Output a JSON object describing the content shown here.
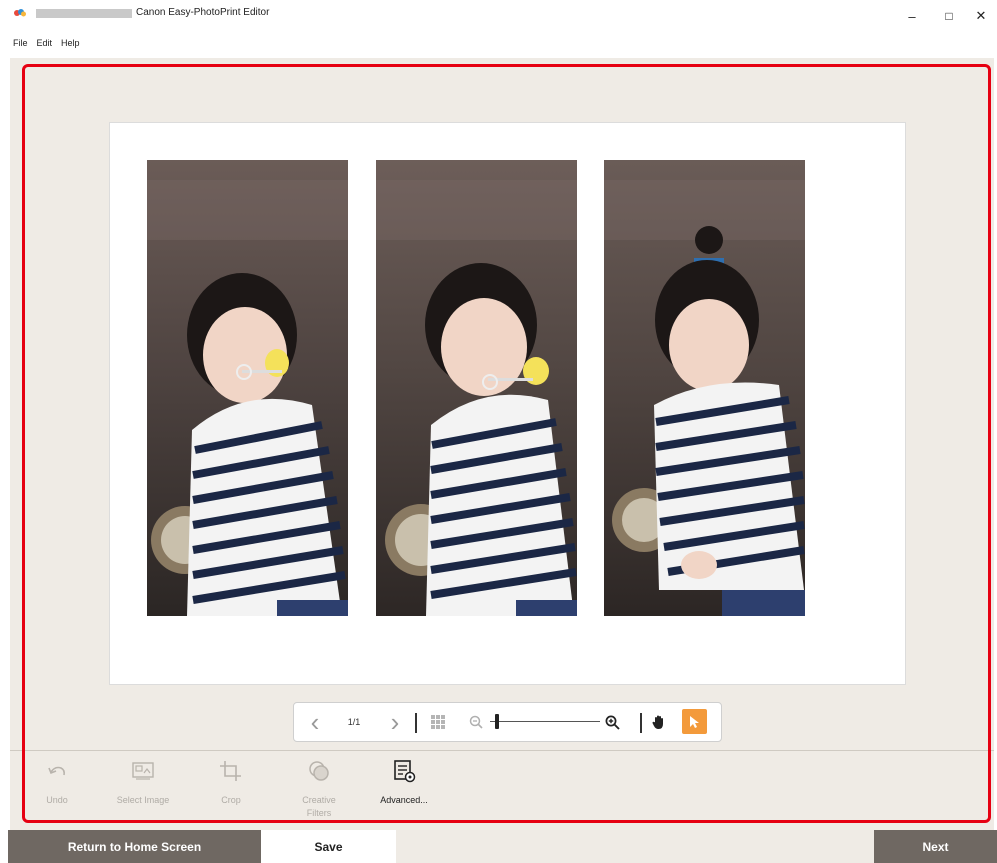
{
  "window": {
    "title": "Canon Easy-PhotoPrint Editor",
    "minimize_glyph": "–",
    "maximize_glyph": "□",
    "close_glyph": "✕"
  },
  "menu": {
    "items": [
      {
        "label": "File"
      },
      {
        "label": "Edit"
      },
      {
        "label": "Help"
      }
    ]
  },
  "canvas": {
    "photos": [
      {
        "icon": "photo-girl-blowing-bubbles-1"
      },
      {
        "icon": "photo-girl-blowing-bubbles-2"
      },
      {
        "icon": "photo-girl-smiling"
      }
    ]
  },
  "navigation": {
    "prev_glyph": "‹",
    "page_indicator": "1/1",
    "next_glyph": "›",
    "zoom_level": 0.05
  },
  "toolbar": {
    "tools": [
      {
        "label": "Undo",
        "icon": "undo-icon",
        "enabled": false
      },
      {
        "label": "Select Image",
        "icon": "select-image-icon",
        "enabled": false
      },
      {
        "label": "Crop",
        "icon": "crop-icon",
        "enabled": false
      },
      {
        "label": "Creative Filters",
        "icon": "creative-filters-icon",
        "enabled": false
      },
      {
        "label": "Advanced...",
        "icon": "advanced-icon",
        "enabled": true
      }
    ]
  },
  "footer": {
    "return_label": "Return to Home Screen",
    "save_label": "Save",
    "next_label": "Next"
  },
  "colors": {
    "highlight_frame": "#e60012",
    "accent_orange": "#f39a3b",
    "footer_button": "#6f6862",
    "workspace_bg": "#efebe5"
  }
}
